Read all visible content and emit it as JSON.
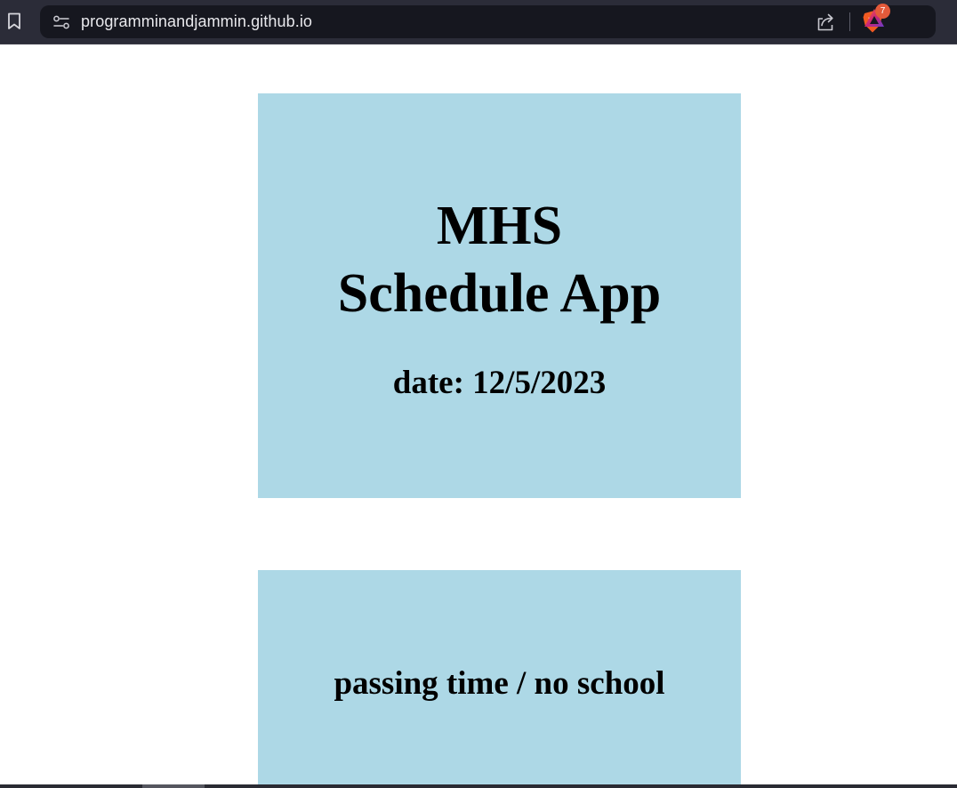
{
  "browser": {
    "url": "programminandjammin.github.io",
    "rewards_badge_count": "7",
    "icons": {
      "bookmark": "bookmark-icon",
      "site_info": "site-settings-icon",
      "share": "share-icon",
      "shields": "brave-shields-icon",
      "rewards": "brave-rewards-icon"
    },
    "colors": {
      "toolbar": "#2b2c38",
      "url_box": "#16171f",
      "shields": "#f15a22",
      "badge": "#e45a3a"
    }
  },
  "header": {
    "title_line1": "MHS",
    "title_line2": "Schedule App",
    "date": "date: 12/5/2023"
  },
  "period": {
    "status": "passing time / no school"
  },
  "colors": {
    "card_background": "#add8e6",
    "page_background": "#ffffff",
    "text": "#000000"
  }
}
